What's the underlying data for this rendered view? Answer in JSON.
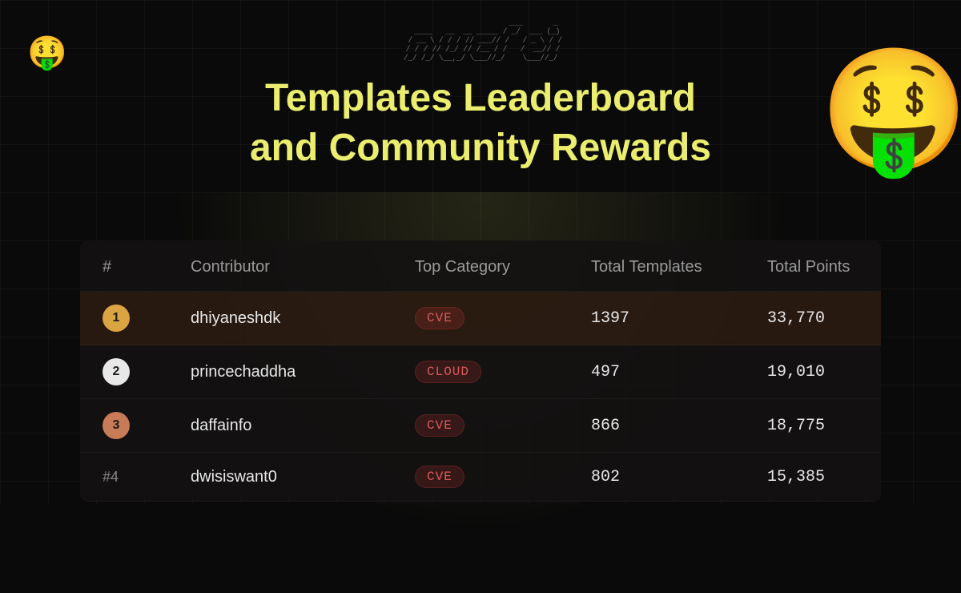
{
  "logo_ascii": "                        ___       _\n   ____   __  __ _____ / _/  ___ (_)\n  / __ \\ / / / // ___// /   / _ \\ / /\n / / / // /_/ // /__ / /   /  __// /\n/_/ /_/ \\__,_/ \\___//_/    \\___//_/",
  "emoji": "🤑",
  "title_line1": "Templates Leaderboard",
  "title_line2": "and Community Rewards",
  "headers": {
    "rank": "#",
    "contributor": "Contributor",
    "category": "Top Category",
    "templates": "Total Templates",
    "points": "Total Points"
  },
  "rows": [
    {
      "rank": "1",
      "contributor": "dhiyaneshdk",
      "category": "CVE",
      "templates": "1397",
      "points": "33,770"
    },
    {
      "rank": "2",
      "contributor": "princechaddha",
      "category": "CLOUD",
      "templates": "497",
      "points": "19,010"
    },
    {
      "rank": "3",
      "contributor": "daffainfo",
      "category": "CVE",
      "templates": "866",
      "points": "18,775"
    },
    {
      "rank": "#4",
      "contributor": "dwisiswant0",
      "category": "CVE",
      "templates": "802",
      "points": "15,385"
    }
  ]
}
